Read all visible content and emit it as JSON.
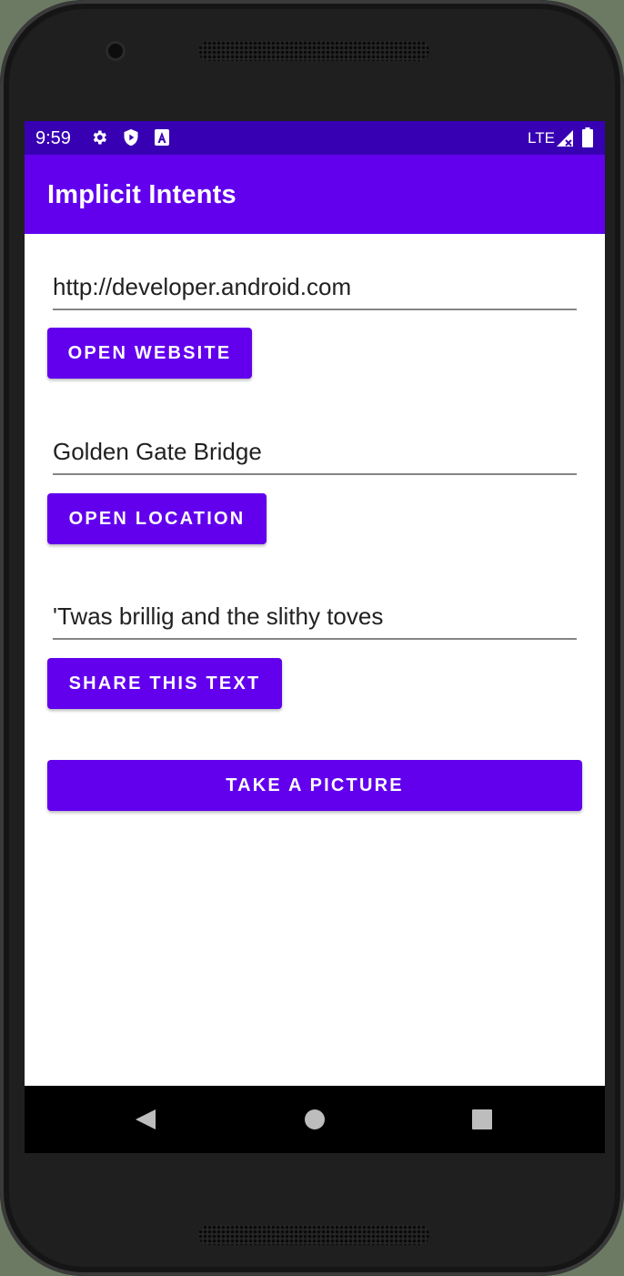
{
  "status_bar": {
    "time": "9:59",
    "icons_left": [
      "gear-icon",
      "shield-play-icon",
      "font-a-icon"
    ],
    "network": "LTE",
    "icons_right": [
      "signal-icon",
      "battery-icon"
    ]
  },
  "app_bar": {
    "title": "Implicit Intents"
  },
  "main": {
    "website_input": {
      "value": "http://developer.android.com"
    },
    "open_website_button": "Open Website",
    "location_input": {
      "value": "Golden Gate Bridge"
    },
    "open_location_button": "Open Location",
    "share_input": {
      "value": "'Twas brillig and the slithy toves"
    },
    "share_text_button": "Share This Text",
    "take_picture_button": "Take A Picture"
  },
  "nav_bar": {
    "items": [
      "back-icon",
      "home-icon",
      "recents-icon"
    ]
  },
  "colors": {
    "status_bar": "#3700b3",
    "primary": "#6200ee",
    "nav_bar": "#000000",
    "background": "#ffffff"
  }
}
